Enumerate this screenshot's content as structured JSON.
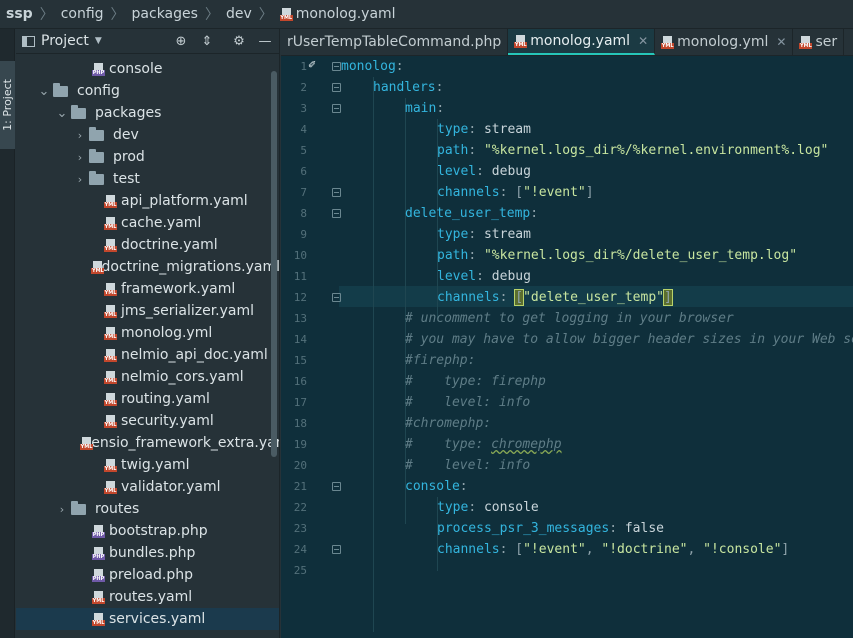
{
  "breadcrumb": {
    "items": [
      "ssp",
      "config",
      "packages",
      "dev",
      "monolog.yaml"
    ],
    "file_badge": "YML"
  },
  "stripe": {
    "project_tab": "1: Project"
  },
  "project_panel": {
    "title": "Project",
    "tree": [
      {
        "label": "console",
        "type": "php",
        "depth": 3,
        "arrow": ""
      },
      {
        "label": "config",
        "type": "folder",
        "depth": 1,
        "arrow": "down"
      },
      {
        "label": "packages",
        "type": "folder",
        "depth": 2,
        "arrow": "down"
      },
      {
        "label": "dev",
        "type": "folder",
        "depth": 3,
        "arrow": "right"
      },
      {
        "label": "prod",
        "type": "folder",
        "depth": 3,
        "arrow": "right"
      },
      {
        "label": "test",
        "type": "folder",
        "depth": 3,
        "arrow": "right"
      },
      {
        "label": "api_platform.yaml",
        "type": "yml",
        "depth": 4,
        "arrow": ""
      },
      {
        "label": "cache.yaml",
        "type": "yml",
        "depth": 4,
        "arrow": ""
      },
      {
        "label": "doctrine.yaml",
        "type": "yml",
        "depth": 4,
        "arrow": ""
      },
      {
        "label": "doctrine_migrations.yaml",
        "type": "yml",
        "depth": 4,
        "arrow": ""
      },
      {
        "label": "framework.yaml",
        "type": "yml",
        "depth": 4,
        "arrow": ""
      },
      {
        "label": "jms_serializer.yaml",
        "type": "yml",
        "depth": 4,
        "arrow": ""
      },
      {
        "label": "monolog.yml",
        "type": "yml",
        "depth": 4,
        "arrow": ""
      },
      {
        "label": "nelmio_api_doc.yaml",
        "type": "yml",
        "depth": 4,
        "arrow": ""
      },
      {
        "label": "nelmio_cors.yaml",
        "type": "yml",
        "depth": 4,
        "arrow": ""
      },
      {
        "label": "routing.yaml",
        "type": "yml",
        "depth": 4,
        "arrow": ""
      },
      {
        "label": "security.yaml",
        "type": "yml",
        "depth": 4,
        "arrow": ""
      },
      {
        "label": "sensio_framework_extra.yaml",
        "type": "yml",
        "depth": 4,
        "arrow": ""
      },
      {
        "label": "twig.yaml",
        "type": "yml",
        "depth": 4,
        "arrow": ""
      },
      {
        "label": "validator.yaml",
        "type": "yml",
        "depth": 4,
        "arrow": ""
      },
      {
        "label": "routes",
        "type": "folder",
        "depth": 2,
        "arrow": "right"
      },
      {
        "label": "bootstrap.php",
        "type": "php",
        "depth": 3,
        "arrow": ""
      },
      {
        "label": "bundles.php",
        "type": "php",
        "depth": 3,
        "arrow": ""
      },
      {
        "label": "preload.php",
        "type": "php",
        "depth": 3,
        "arrow": ""
      },
      {
        "label": "routes.yaml",
        "type": "yml",
        "depth": 3,
        "arrow": ""
      },
      {
        "label": "services.yaml",
        "type": "yml",
        "depth": 3,
        "arrow": "",
        "selected": true
      }
    ]
  },
  "tabs": [
    {
      "label": "rUserTempTableCommand.php",
      "badge": "",
      "active": false,
      "close": false
    },
    {
      "label": "monolog.yaml",
      "badge": "YML",
      "active": true,
      "close": true
    },
    {
      "label": "monolog.yml",
      "badge": "YML",
      "active": false,
      "close": true
    },
    {
      "label": "ser",
      "badge": "YML",
      "active": false,
      "close": false
    }
  ],
  "editor": {
    "lines": [
      [
        [
          "k",
          "monolog"
        ],
        [
          "p",
          ":"
        ]
      ],
      [
        [
          "i",
          1
        ],
        [
          "k",
          "handlers"
        ],
        [
          "p",
          ":"
        ]
      ],
      [
        [
          "i",
          2
        ],
        [
          "k",
          "main"
        ],
        [
          "p",
          ":"
        ]
      ],
      [
        [
          "i",
          3
        ],
        [
          "k",
          "type"
        ],
        [
          "p",
          ": "
        ],
        [
          "v",
          "stream"
        ]
      ],
      [
        [
          "i",
          3
        ],
        [
          "k",
          "path"
        ],
        [
          "p",
          ": "
        ],
        [
          "s",
          "\"%kernel.logs_dir%/%kernel.environment%.log\""
        ]
      ],
      [
        [
          "i",
          3
        ],
        [
          "k",
          "level"
        ],
        [
          "p",
          ": "
        ],
        [
          "v",
          "debug"
        ]
      ],
      [
        [
          "i",
          3
        ],
        [
          "k",
          "channels"
        ],
        [
          "p",
          ": "
        ],
        [
          "p",
          "["
        ],
        [
          "s",
          "\"!event\""
        ],
        [
          "p",
          "]"
        ]
      ],
      [
        [
          "i",
          2
        ],
        [
          "k",
          "delete_user_temp"
        ],
        [
          "p",
          ":"
        ]
      ],
      [
        [
          "i",
          3
        ],
        [
          "k",
          "type"
        ],
        [
          "p",
          ": "
        ],
        [
          "v",
          "stream"
        ]
      ],
      [
        [
          "i",
          3
        ],
        [
          "k",
          "path"
        ],
        [
          "p",
          ": "
        ],
        [
          "s",
          "\"%kernel.logs_dir%/delete_user_temp.log\""
        ]
      ],
      [
        [
          "i",
          3
        ],
        [
          "k",
          "level"
        ],
        [
          "p",
          ": "
        ],
        [
          "v",
          "debug"
        ]
      ],
      [
        [
          "i",
          3
        ],
        [
          "k",
          "channels"
        ],
        [
          "p",
          ": "
        ],
        [
          "br",
          "["
        ],
        [
          "s",
          "\"delete_user_temp\""
        ],
        [
          "br",
          "]"
        ]
      ],
      [
        [
          "i",
          2
        ],
        [
          "c",
          "# uncomment to get logging in your browser"
        ]
      ],
      [
        [
          "i",
          2
        ],
        [
          "c",
          "# you may have to allow bigger header sizes in your Web server configuration"
        ]
      ],
      [
        [
          "i",
          2
        ],
        [
          "c",
          "#firephp:"
        ]
      ],
      [
        [
          "i",
          2
        ],
        [
          "c",
          "#    type: firephp"
        ]
      ],
      [
        [
          "i",
          2
        ],
        [
          "c",
          "#    level: info"
        ]
      ],
      [
        [
          "i",
          2
        ],
        [
          "c",
          "#chromephp:"
        ]
      ],
      [
        [
          "i",
          2
        ],
        [
          "c",
          "#    type: "
        ],
        [
          "cu",
          "chromephp"
        ]
      ],
      [
        [
          "i",
          2
        ],
        [
          "c",
          "#    level: info"
        ]
      ],
      [
        [
          "i",
          2
        ],
        [
          "k",
          "console"
        ],
        [
          "p",
          ":"
        ]
      ],
      [
        [
          "i",
          3
        ],
        [
          "k",
          "type"
        ],
        [
          "p",
          ": "
        ],
        [
          "v",
          "console"
        ]
      ],
      [
        [
          "i",
          3
        ],
        [
          "k",
          "process_psr_3_messages"
        ],
        [
          "p",
          ": "
        ],
        [
          "v",
          "false"
        ]
      ],
      [
        [
          "i",
          3
        ],
        [
          "k",
          "channels"
        ],
        [
          "p",
          ": "
        ],
        [
          "p",
          "["
        ],
        [
          "s",
          "\"!event\""
        ],
        [
          "p",
          ", "
        ],
        [
          "s",
          "\"!doctrine\""
        ],
        [
          "p",
          ", "
        ],
        [
          "s",
          "\"!console\""
        ],
        [
          "p",
          "]"
        ]
      ],
      []
    ],
    "line_numbers": [
      "1",
      "2",
      "3",
      "4",
      "5",
      "6",
      "7",
      "8",
      "9",
      "10",
      "11",
      "12",
      "13",
      "14",
      "15",
      "16",
      "17",
      "18",
      "19",
      "20",
      "21",
      "22",
      "23",
      "24",
      "25"
    ]
  },
  "colors": {
    "editor_bg": "#0f2f3b",
    "key": "#33b5de",
    "string": "#c8e6a0",
    "comment": "#5f7d87",
    "active_tab_underline": "#26c6b9"
  }
}
